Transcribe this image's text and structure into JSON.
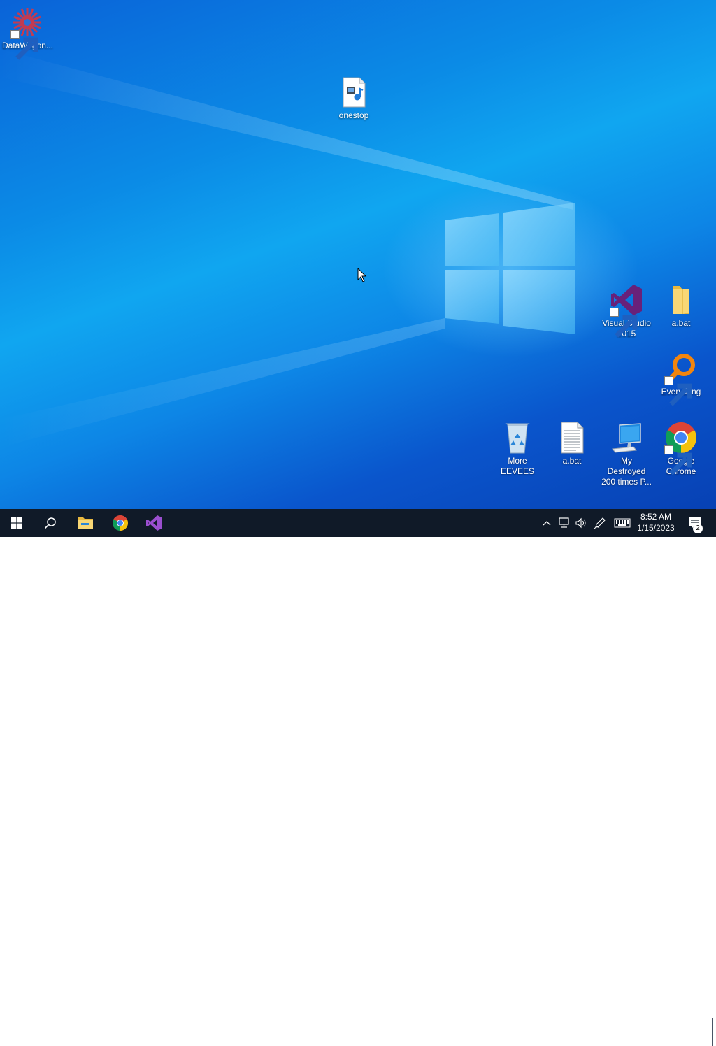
{
  "desktop": {
    "icons": [
      {
        "label": "DataWagon...",
        "icon": "datawagon-gear-icon",
        "shortcut": true
      },
      {
        "label": "onestop",
        "icon": "media-file-icon",
        "shortcut": false
      },
      {
        "label": "Visual Studio 2015",
        "icon": "visual-studio-icon",
        "shortcut": true
      },
      {
        "label": "a.bat",
        "icon": "folder-icon",
        "shortcut": false
      },
      {
        "label": "Everything",
        "icon": "everything-search-icon",
        "shortcut": true
      },
      {
        "label": "More EEVEES",
        "icon": "recycle-bin-icon",
        "shortcut": false
      },
      {
        "label": "a.bat",
        "icon": "text-file-icon",
        "shortcut": false
      },
      {
        "label": "My Destroyed 200 times P...",
        "icon": "this-pc-icon",
        "shortcut": false
      },
      {
        "label": "Google Chrome",
        "icon": "chrome-icon",
        "shortcut": true
      }
    ],
    "accent": "#0a78e0"
  },
  "taskbar": {
    "buttons": [
      "start-button",
      "search-button",
      "file-explorer",
      "chrome",
      "visual-studio"
    ],
    "tray_icons": [
      "chevron-up-icon",
      "network-icon",
      "volume-icon",
      "pen-icon",
      "keyboard-icon"
    ],
    "clock": {
      "time": "8:52 AM",
      "date": "1/15/2023"
    },
    "notifications": {
      "count": "2"
    }
  }
}
